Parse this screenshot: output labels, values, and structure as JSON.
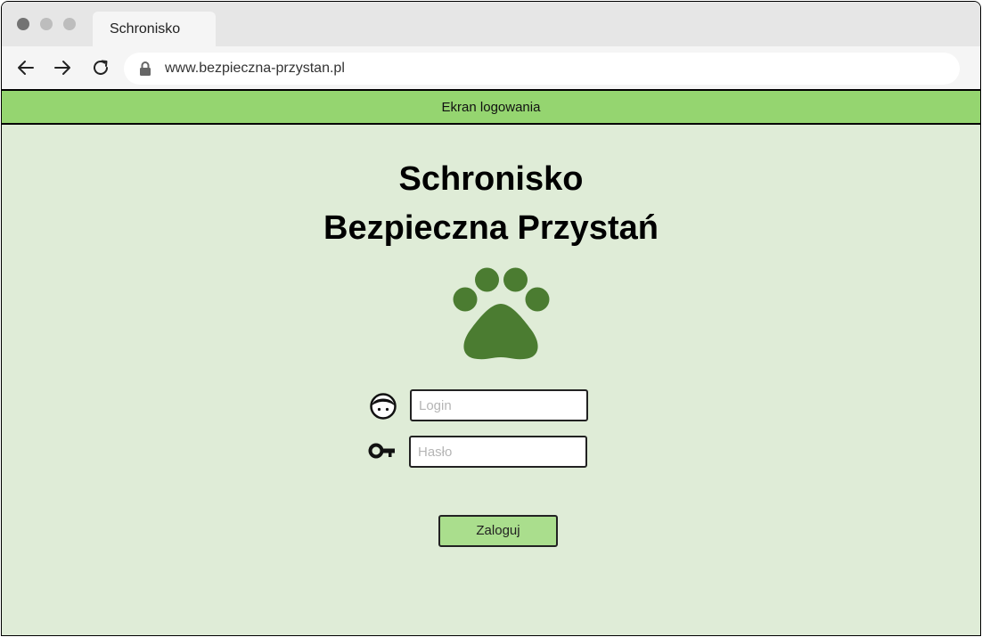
{
  "browser": {
    "tab_title": "Schronisko",
    "url": "www.bezpieczna-przystan.pl",
    "icons": [
      "back-arrow-icon",
      "forward-arrow-icon",
      "reload-icon",
      "lock-icon"
    ]
  },
  "header": {
    "label": "Ekran logowania"
  },
  "main": {
    "title_line1": "Schronisko",
    "title_line2": "Bezpieczna Przystań",
    "logo_icon": "paw-icon",
    "login": {
      "icon": "user-face-icon",
      "value": "",
      "placeholder": "Login"
    },
    "password": {
      "icon": "key-icon",
      "value": "",
      "placeholder": "Hasło"
    },
    "submit_label": "Zaloguj"
  },
  "colors": {
    "header_bg": "#95d570",
    "content_bg": "#dfecd7",
    "paw": "#4b7c31",
    "button_bg": "#aade8d"
  }
}
